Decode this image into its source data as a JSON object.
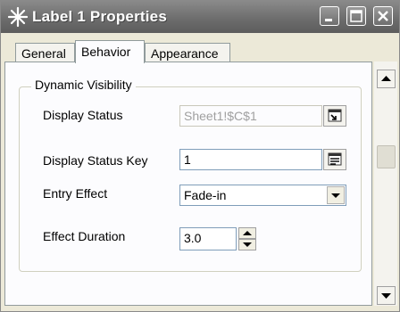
{
  "window": {
    "title": "Label 1 Properties"
  },
  "tabs": [
    {
      "label": "General"
    },
    {
      "label": "Behavior"
    },
    {
      "label": "Appearance"
    }
  ],
  "group": {
    "title": "Dynamic Visibility",
    "rows": [
      {
        "label": "Display Status",
        "value": "Sheet1!$C$1"
      },
      {
        "label": "Display Status Key",
        "value": "1"
      },
      {
        "label": "Entry Effect",
        "value": "Fade-in"
      },
      {
        "label": "Effect Duration",
        "value": "3.0"
      }
    ]
  },
  "icons": {
    "window": "star-icon",
    "cell_ref_button": "cell-reference-icon",
    "list_button": "list-select-icon"
  },
  "colors": {
    "titlebar": "#6b6b6b",
    "panel": "#fcfcfe",
    "window_bg": "#ece9d8"
  }
}
